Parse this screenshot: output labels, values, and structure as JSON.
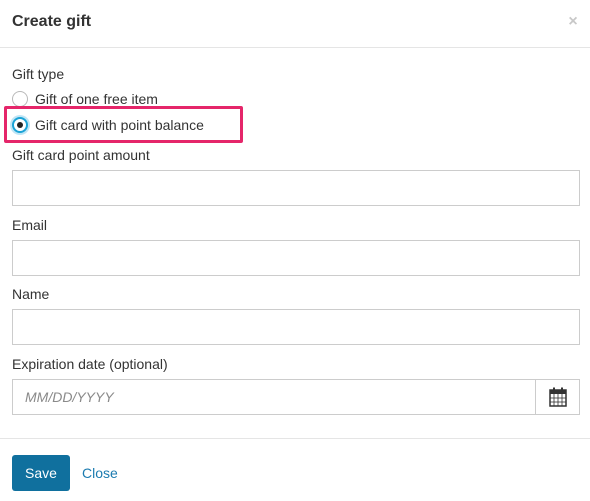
{
  "dialog": {
    "title": "Create gift",
    "close_glyph": "×"
  },
  "gift_type": {
    "label": "Gift type",
    "options": [
      {
        "label": "Gift of one free item",
        "selected": false
      },
      {
        "label": "Gift card with point balance",
        "selected": true
      }
    ]
  },
  "fields": {
    "points": {
      "label": "Gift card point amount",
      "value": "",
      "placeholder": ""
    },
    "email": {
      "label": "Email",
      "value": "",
      "placeholder": ""
    },
    "name": {
      "label": "Name",
      "value": "",
      "placeholder": ""
    },
    "expiration": {
      "label": "Expiration date (optional)",
      "value": "",
      "placeholder": "MM/DD/YYYY"
    }
  },
  "footer": {
    "save_label": "Save",
    "close_label": "Close"
  },
  "colors": {
    "primary": "#10709e",
    "link": "#1b7bb0",
    "highlight": "#e5266a",
    "radio_focus": "#1aa3d6"
  },
  "icons": {
    "calendar": "calendar-icon",
    "close": "close-icon"
  }
}
